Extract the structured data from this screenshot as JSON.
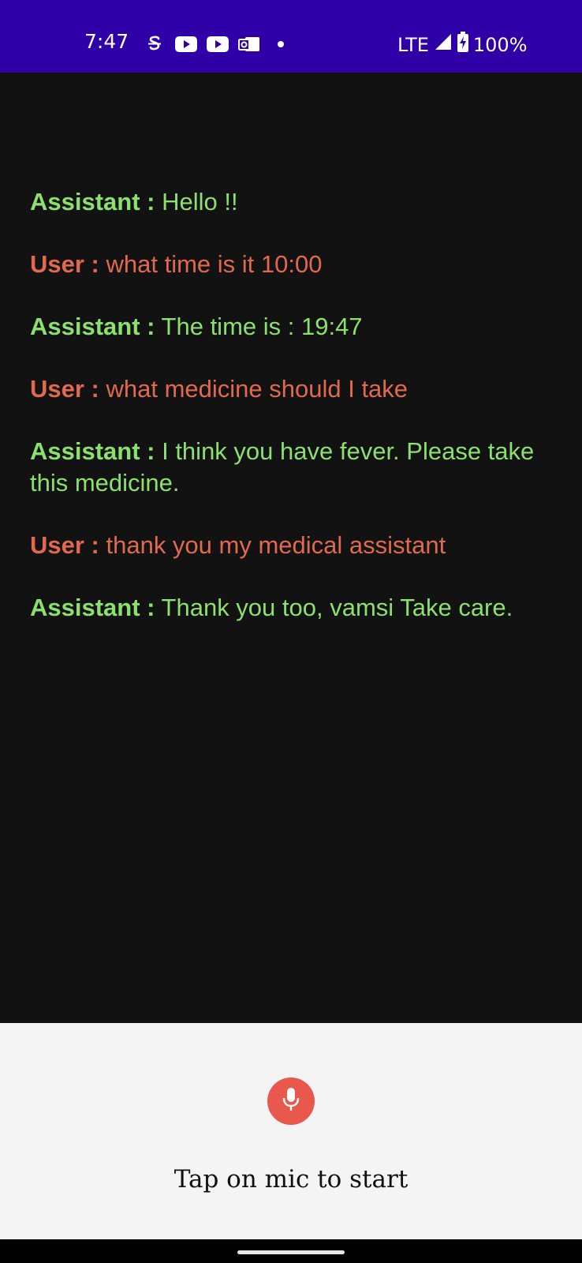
{
  "status_bar": {
    "time": "7:47",
    "network": "LTE",
    "battery": "100%",
    "icons": [
      "sim-toolkit-icon",
      "youtube-icon",
      "youtube-icon",
      "outlook-icon",
      "dot-icon",
      "signal-icon",
      "battery-charging-icon"
    ],
    "background": "#2f00a8"
  },
  "chat": {
    "messages": [
      {
        "speaker": "Assistant :",
        "text": " Hello !!",
        "role": "assistant"
      },
      {
        "speaker": "User :",
        "text": " what time is it 10:00",
        "role": "user"
      },
      {
        "speaker": "Assistant :",
        "text": " The time is : 19:47",
        "role": "assistant"
      },
      {
        "speaker": "User :",
        "text": " what medicine should I take",
        "role": "user"
      },
      {
        "speaker": "Assistant :",
        "text": " I think you have fever. Please take this medicine.",
        "role": "assistant"
      },
      {
        "speaker": "User :",
        "text": " thank you my medical assistant",
        "role": "user"
      },
      {
        "speaker": "Assistant :",
        "text": " Thank you too, vamsi Take care.",
        "role": "assistant"
      }
    ],
    "assistant_color": "#8be06e",
    "user_color": "#e0694e"
  },
  "bottom": {
    "mic_icon": "microphone-icon",
    "hint": "Tap on mic to start",
    "mic_color": "#e8584d"
  }
}
